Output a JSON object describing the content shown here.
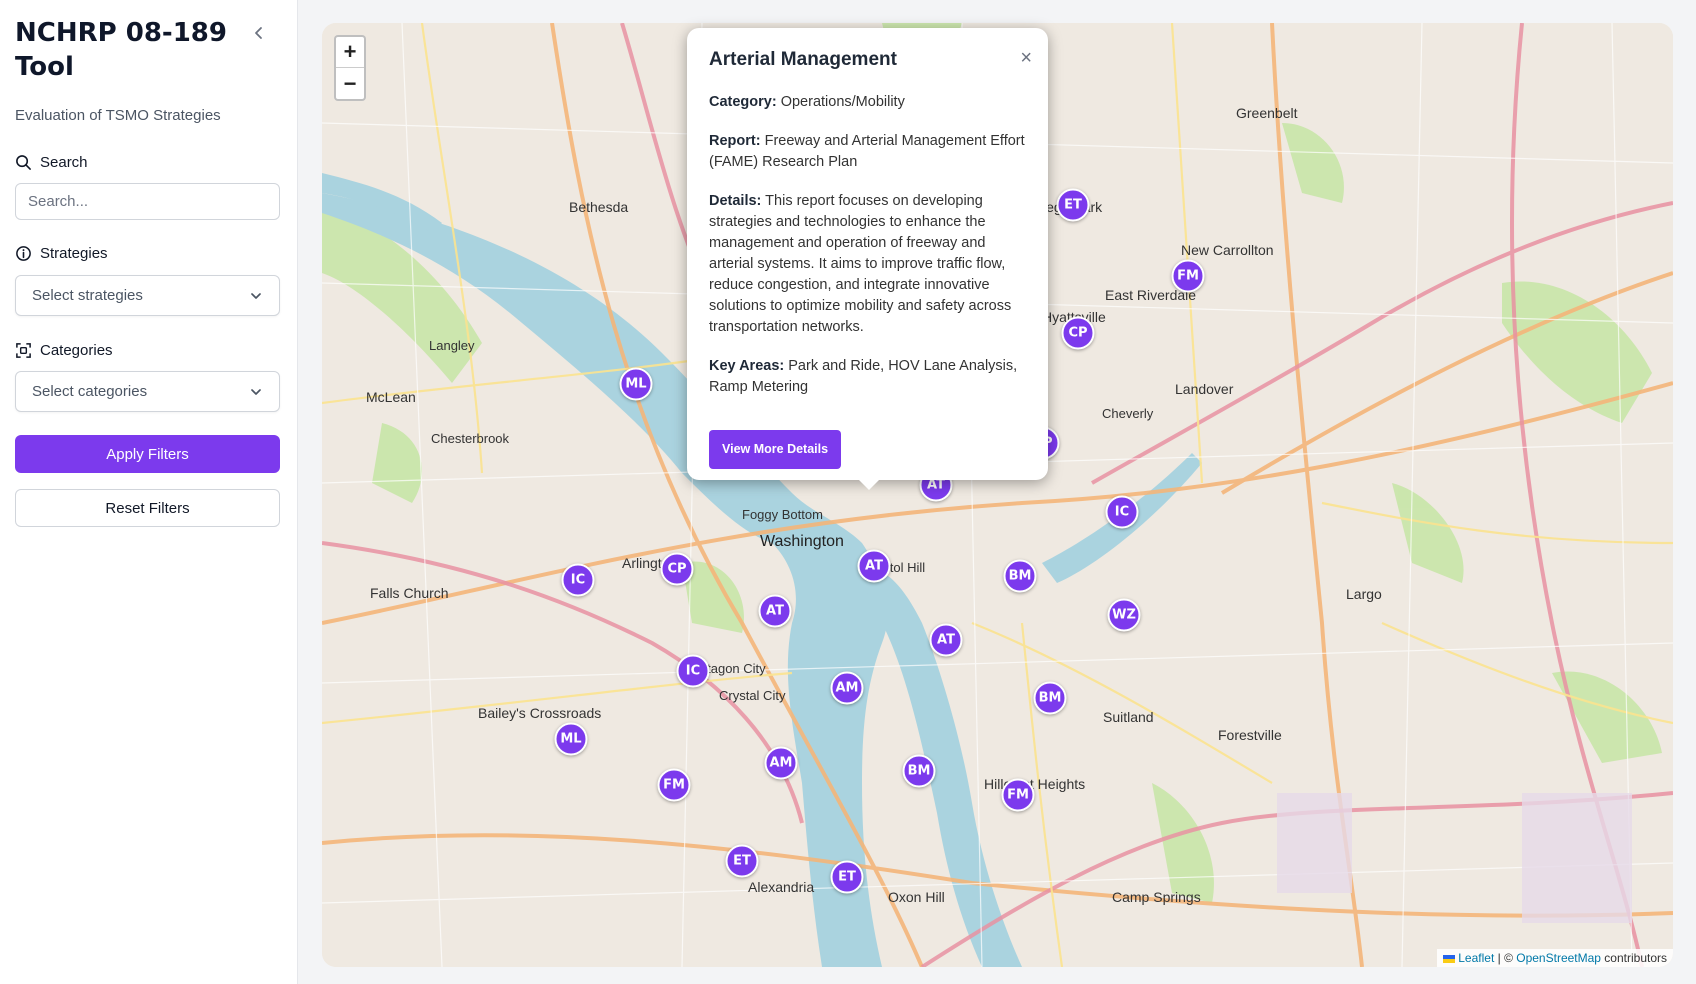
{
  "sidebar": {
    "title": "NCHRP 08-189 Tool",
    "subtitle": "Evaluation of TSMO Strategies",
    "search_label": "Search",
    "search_placeholder": "Search...",
    "strategies_label": "Strategies",
    "strategies_placeholder": "Select strategies",
    "categories_label": "Categories",
    "categories_placeholder": "Select categories",
    "apply_label": "Apply Filters",
    "reset_label": "Reset Filters"
  },
  "map": {
    "zoom_in": "+",
    "zoom_out": "−",
    "labels": {
      "washington": "Washington",
      "arlington": "Arlington",
      "bethesda": "Bethesda",
      "falls_church": "Falls Church",
      "mclean": "McLean",
      "hyattsville": "Hyattsville",
      "new_carrollton": "New Carrollton",
      "greenbelt": "Greenbelt",
      "largo": "Largo",
      "suitland": "Suitland",
      "forestville": "Forestville",
      "alexandria": "Alexandria",
      "baileys": "Bailey's Crossroads",
      "hillcrest": "Hillcrest Heights",
      "camp_springs": "Camp Springs",
      "oxon_hill": "Oxon Hill",
      "landover": "Landover",
      "east_riverdale": "East Riverdale",
      "capitol_hill": "Capitol Hill",
      "foggy_bottom": "Foggy Bottom",
      "chesterbrook": "Chesterbrook",
      "langley": "Langley",
      "cheverly": "Cheverly",
      "pentagon_city": "Pentagon City",
      "crystal_city": "Crystal City",
      "college_park": "College Park"
    },
    "markers": [
      {
        "code": "ET"
      },
      {
        "code": "FM"
      },
      {
        "code": "CP"
      },
      {
        "code": "ML"
      },
      {
        "code": "CP"
      },
      {
        "code": "AT"
      },
      {
        "code": "IC"
      },
      {
        "code": "IC"
      },
      {
        "code": "CP"
      },
      {
        "code": "AT"
      },
      {
        "code": "BM"
      },
      {
        "code": "AT"
      },
      {
        "code": "WZ"
      },
      {
        "code": "AT"
      },
      {
        "code": "IC"
      },
      {
        "code": "AM"
      },
      {
        "code": "BM"
      },
      {
        "code": "ML"
      },
      {
        "code": "AM"
      },
      {
        "code": "BM"
      },
      {
        "code": "FM"
      },
      {
        "code": "FM"
      },
      {
        "code": "ET"
      },
      {
        "code": "ET"
      }
    ],
    "attribution": {
      "leaflet": "Leaflet",
      "sep": " | © ",
      "osm": "OpenStreetMap",
      "contributors": " contributors"
    }
  },
  "popup": {
    "title": "Arterial Management",
    "close": "×",
    "category_label": "Category:",
    "category_value": "Operations/Mobility",
    "report_label": "Report:",
    "report_value": "Freeway and Arterial Management Effort (FAME) Research Plan",
    "details_label": "Details:",
    "details_value": "This report focuses on developing strategies and technologies to enhance the management and operation of freeway and arterial systems. It aims to improve traffic flow, reduce congestion, and integrate innovative solutions to optimize mobility and safety across transportation networks.",
    "key_areas_label": "Key Areas:",
    "key_areas_value": "Park and Ride, HOV Lane Analysis, Ramp Metering",
    "button": "View More Details"
  },
  "colors": {
    "accent": "#7c3aed",
    "map_land": "#eee9e0",
    "map_water": "#aad3df",
    "map_park": "#c8e6a8"
  }
}
